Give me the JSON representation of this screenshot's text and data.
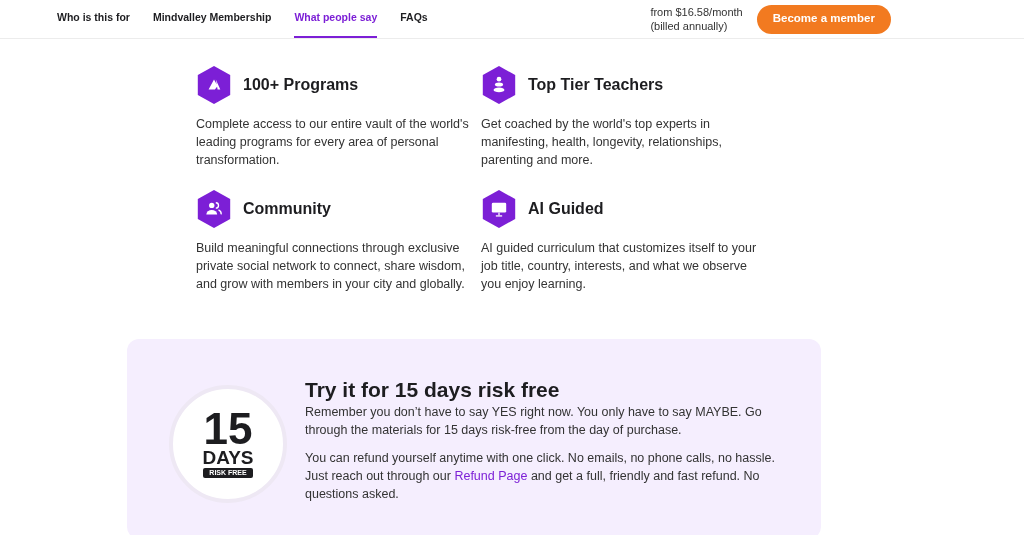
{
  "nav": {
    "tabs": [
      {
        "label": "Who is this for",
        "selected": false
      },
      {
        "label": "Mindvalley Membership",
        "selected": false
      },
      {
        "label": "What people say",
        "selected": true
      },
      {
        "label": "FAQs",
        "selected": false
      }
    ],
    "price": "from $16.58/month",
    "billing": "(billed annually)",
    "cta": "Become a member"
  },
  "features": [
    {
      "kind": "programs",
      "title": "100+ Programs",
      "text": "Complete access to our entire vault of the world's leading programs for every area of personal transformation."
    },
    {
      "kind": "teachers",
      "title": "Top Tier Teachers",
      "text": "Get coached by the world's top experts in manifesting, health, longevity, relationships, parenting and more."
    },
    {
      "kind": "community",
      "title": "Community",
      "text": "Build meaningful connections through exclusive private social network to connect, share wisdom, and grow with members in your city and globally."
    },
    {
      "kind": "ai",
      "title": "AI Guided",
      "text": "AI guided curriculum that customizes itself to your job title, country, interests, and what we observe you enjoy learning."
    }
  ],
  "trial": {
    "badge": {
      "number": "15",
      "unit": "DAYS",
      "tag": "RISK FREE"
    },
    "title": "Try it for 15 days risk free",
    "paragraph_1": "Remember you don’t have to say YES right now. You only have to say MAYBE. Go through the materials for 15 days risk-free from the day of purchase.",
    "paragraph_2": {
      "before": "You can refund yourself anytime with one click. No emails, no phone calls, no hassle. Just reach out through our",
      "link": "Refund Page",
      "after": "and get a full, friendly and fast refund. No questions asked."
    }
  }
}
